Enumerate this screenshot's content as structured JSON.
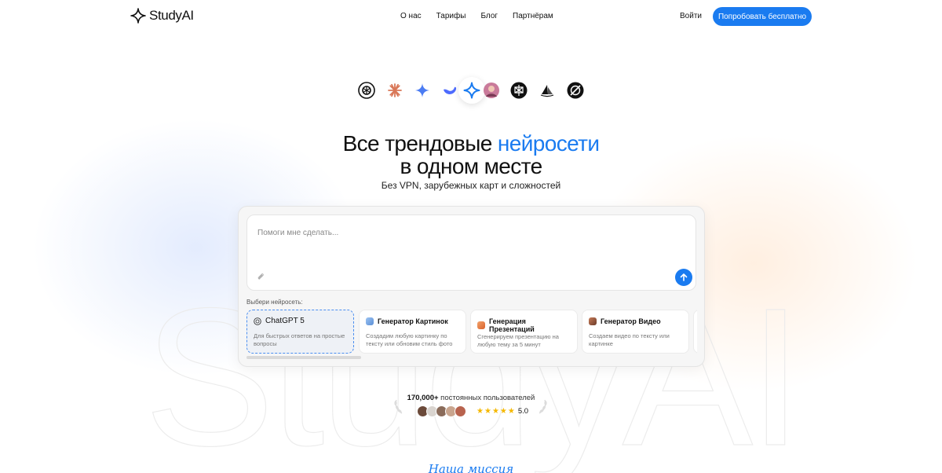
{
  "brand": {
    "name": "StudyAI"
  },
  "nav": {
    "items": [
      {
        "label": "О нас"
      },
      {
        "label": "Тарифы"
      },
      {
        "label": "Блог"
      },
      {
        "label": "Партнёрам"
      }
    ],
    "login_label": "Войти",
    "cta_label": "Попробовать бесплатно"
  },
  "ai_icons": [
    "openai-icon",
    "claude-icon",
    "gemini-icon",
    "deepseek-icon",
    "studyai-star-icon",
    "avatar-icon",
    "perplexity-icon",
    "midjourney-icon",
    "grok-icon"
  ],
  "hero": {
    "title_part1": "Все трендовые ",
    "title_accent": "нейросети",
    "title_part2": "в одном месте",
    "subtitle": "Без VPN, зарубежных карт и сложностей"
  },
  "prompt": {
    "placeholder": "Помоги мне сделать..."
  },
  "models": {
    "label": "Выбери нейросеть:",
    "items": [
      {
        "title": "ChatGPT 5",
        "desc": "Для быстрых ответов на простые вопросы",
        "icon": "openai-icon",
        "selected": true
      },
      {
        "title": "Генератор Картинок",
        "desc": "Создадим любую картинку по тексту или обновим стиль фото",
        "icon": "image-icon",
        "selected": false
      },
      {
        "title": "Генерация Презентаций",
        "desc": "Сгенерируем презентацию  на любую тему за 5 минут",
        "icon": "presentation-icon",
        "selected": false
      },
      {
        "title": "Генератор Видео",
        "desc": "Создаем видео по тексту или картинке",
        "icon": "video-icon",
        "selected": false
      }
    ]
  },
  "social_proof": {
    "count": "170,000+",
    "text": " постоянных пользователей",
    "rating": "5.0",
    "stars": 5
  },
  "mission_title": "Наша миссия",
  "colors": {
    "accent": "#1a7bf0",
    "star": "#f5b800"
  }
}
